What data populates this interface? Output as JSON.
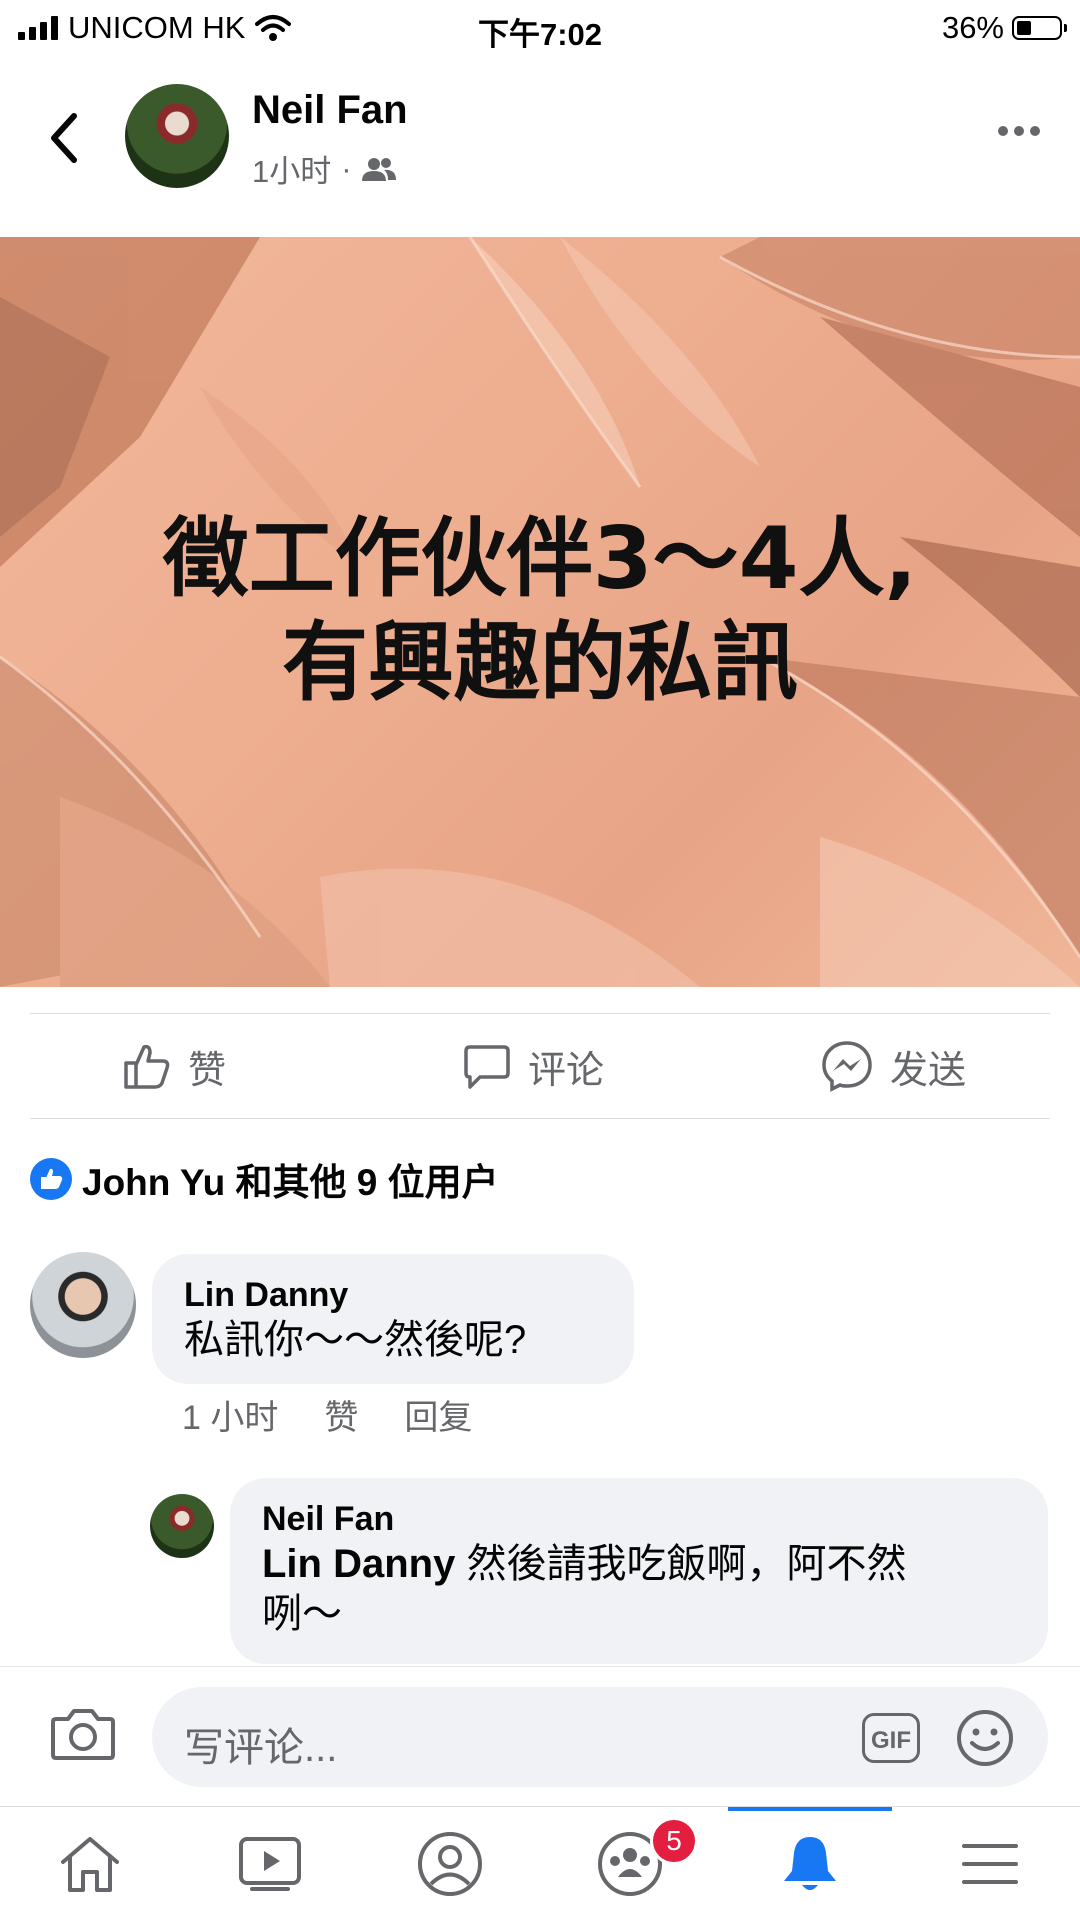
{
  "status_bar": {
    "carrier": "UNICOM HK",
    "time": "下午7:02",
    "battery": "36%"
  },
  "post": {
    "author": "Neil Fan",
    "time_ago": "1小时",
    "separator": "·",
    "audience_icon": "friends-icon",
    "image_text_line1": "徵工作伙伴3～4人,",
    "image_text_line2": "有興趣的私訊"
  },
  "actions": {
    "like": "赞",
    "comment": "评论",
    "send": "发送"
  },
  "reactions": {
    "summary": "John Yu 和其他 9 位用户"
  },
  "comments": [
    {
      "author": "Lin Danny",
      "text": "私訊你～～然後呢?",
      "time": "1 小时",
      "like_label": "赞",
      "reply_label": "回复"
    }
  ],
  "reply": {
    "author": "Neil Fan",
    "mention": "Lin Danny",
    "text_line1": " 然後請我吃飯啊，阿不然",
    "text_line2": "咧～"
  },
  "composer": {
    "placeholder": "写评论...",
    "gif_label": "GIF"
  },
  "nav": {
    "groups_badge": "5"
  },
  "colors": {
    "accent": "#1877f2",
    "badge": "#e41e3f",
    "secondary_text": "#65676b",
    "bubble": "#f0f2f5"
  }
}
